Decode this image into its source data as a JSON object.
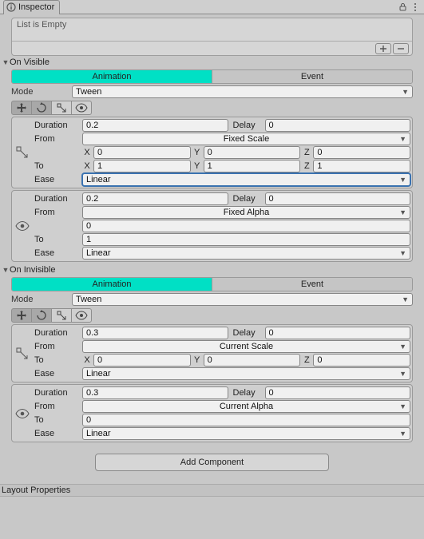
{
  "panel": {
    "title": "Inspector"
  },
  "list_empty": "List is Empty",
  "sections": {
    "visible": {
      "title": "On Visible",
      "tabs": {
        "animation": "Animation",
        "event": "Event"
      },
      "mode_label": "Mode",
      "mode_value": "Tween",
      "anim1": {
        "duration_label": "Duration",
        "duration": "0.2",
        "delay_label": "Delay",
        "delay": "0",
        "from_label": "From",
        "from_value": "Fixed Scale",
        "x": "0",
        "y": "0",
        "z": "0",
        "to_label": "To",
        "tx": "1",
        "ty": "1",
        "tz": "1",
        "ease_label": "Ease",
        "ease_value": "Linear"
      },
      "anim2": {
        "duration_label": "Duration",
        "duration": "0.2",
        "delay_label": "Delay",
        "delay": "0",
        "from_label": "From",
        "from_value": "Fixed Alpha",
        "from_alpha": "0",
        "to_label": "To",
        "to_alpha": "1",
        "ease_label": "Ease",
        "ease_value": "Linear"
      }
    },
    "invisible": {
      "title": "On Invisible",
      "tabs": {
        "animation": "Animation",
        "event": "Event"
      },
      "mode_label": "Mode",
      "mode_value": "Tween",
      "anim1": {
        "duration_label": "Duration",
        "duration": "0.3",
        "delay_label": "Delay",
        "delay": "0",
        "from_label": "From",
        "from_value": "Current Scale",
        "to_label": "To",
        "tx": "0",
        "ty": "0",
        "tz": "0",
        "ease_label": "Ease",
        "ease_value": "Linear"
      },
      "anim2": {
        "duration_label": "Duration",
        "duration": "0.3",
        "delay_label": "Delay",
        "delay": "0",
        "from_label": "From",
        "from_value": "Current Alpha",
        "to_label": "To",
        "to_alpha": "0",
        "ease_label": "Ease",
        "ease_value": "Linear"
      }
    }
  },
  "axis": {
    "x": "X",
    "y": "Y",
    "z": "Z"
  },
  "add_component": "Add Component",
  "footer": "Layout Properties"
}
